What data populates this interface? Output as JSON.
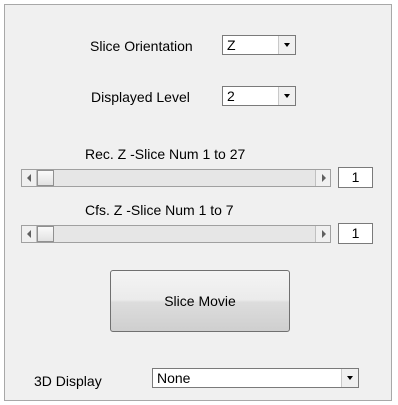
{
  "slice_orientation": {
    "label": "Slice Orientation",
    "value": "Z"
  },
  "displayed_level": {
    "label": "Displayed Level",
    "value": "2"
  },
  "rec_slider": {
    "label": "Rec. Z -Slice Num 1 to 27",
    "value": "1",
    "position": 1,
    "min": 1,
    "max": 27
  },
  "cfs_slider": {
    "label": "Cfs. Z -Slice Num 1 to 7",
    "value": "1",
    "position": 1,
    "min": 1,
    "max": 7
  },
  "slice_movie_button": {
    "label": "Slice Movie"
  },
  "display_3d": {
    "label": "3D Display",
    "value": "None"
  }
}
